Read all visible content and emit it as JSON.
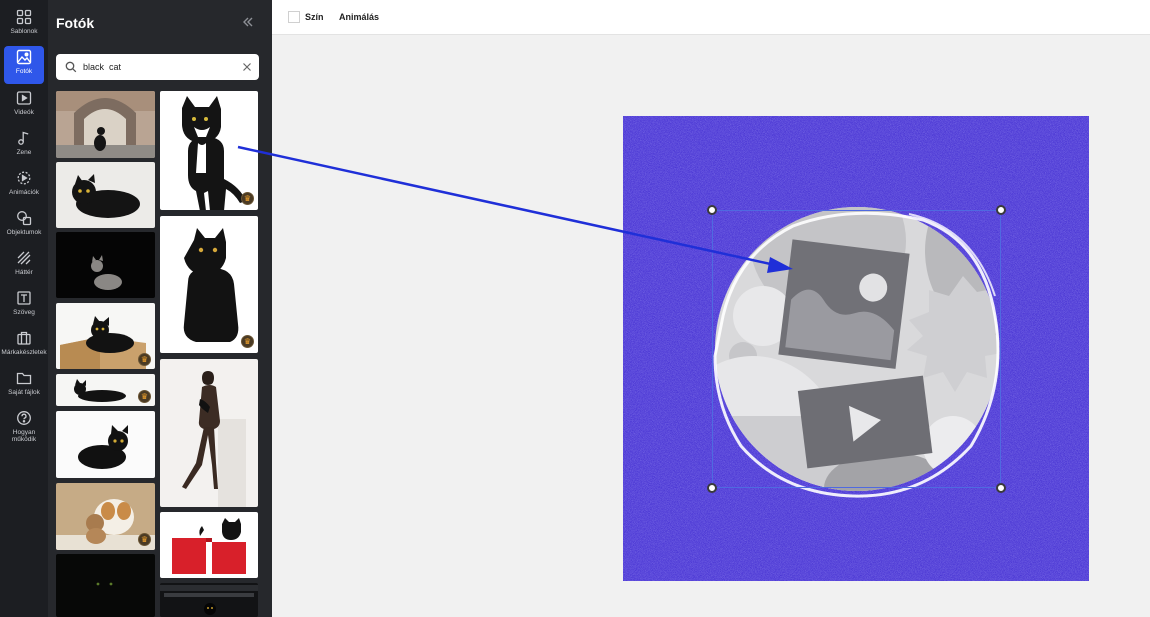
{
  "sidebar": {
    "items": [
      {
        "label": "Sablonok",
        "icon": "grid-icon"
      },
      {
        "label": "Fotók",
        "icon": "image-icon",
        "active": true
      },
      {
        "label": "Videók",
        "icon": "play-icon"
      },
      {
        "label": "Zene",
        "icon": "music-icon"
      },
      {
        "label": "Animációk",
        "icon": "animation-icon"
      },
      {
        "label": "Objektumok",
        "icon": "shapes-icon"
      },
      {
        "label": "Háttér",
        "icon": "background-icon"
      },
      {
        "label": "Szöveg",
        "icon": "text-icon"
      },
      {
        "label": "Márkakészletek",
        "icon": "briefcase-icon"
      },
      {
        "label": "Saját fájlok",
        "icon": "folder-icon"
      },
      {
        "label": "Hogyan működik",
        "icon": "help-icon"
      }
    ]
  },
  "panel": {
    "title": "Fotók",
    "search_value": "black  cat"
  },
  "toolbar": {
    "color_label": "Szín",
    "animate_label": "Animálás"
  },
  "colors": {
    "accent": "#2f57ea",
    "canvas_bg": "#4a36d4",
    "arrow": "#1f2fd8",
    "premium": "#f4a42c"
  }
}
